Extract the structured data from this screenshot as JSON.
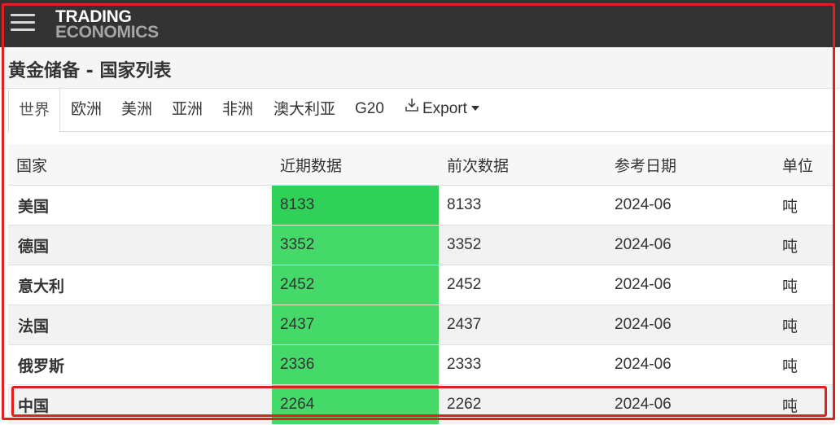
{
  "header": {
    "logo_line1": "TRADING",
    "logo_line2": "ECONOMICS",
    "menu_icon": "hamburger-menu-icon"
  },
  "page_title": "黄金储备 - 国家列表",
  "tabs": [
    {
      "label": "世界",
      "active": true
    },
    {
      "label": "欧洲",
      "active": false
    },
    {
      "label": "美洲",
      "active": false
    },
    {
      "label": "亚洲",
      "active": false
    },
    {
      "label": "非洲",
      "active": false
    },
    {
      "label": "澳大利亚",
      "active": false
    },
    {
      "label": "G20",
      "active": false
    }
  ],
  "export": {
    "label": "Export",
    "icon": "download-icon"
  },
  "table": {
    "headers": [
      "国家",
      "近期数据",
      "前次数据",
      "参考日期",
      "单位"
    ],
    "rows": [
      {
        "country": "美国",
        "latest": "8133",
        "previous": "8133",
        "date": "2024-06",
        "unit": "吨",
        "latest_color": "#2fd158"
      },
      {
        "country": "德国",
        "latest": "3352",
        "previous": "3352",
        "date": "2024-06",
        "unit": "吨",
        "latest_color": "#45d96a"
      },
      {
        "country": "意大利",
        "latest": "2452",
        "previous": "2452",
        "date": "2024-06",
        "unit": "吨",
        "latest_color": "#45d96a"
      },
      {
        "country": "法国",
        "latest": "2437",
        "previous": "2437",
        "date": "2024-06",
        "unit": "吨",
        "latest_color": "#45d96a"
      },
      {
        "country": "俄罗斯",
        "latest": "2336",
        "previous": "2333",
        "date": "2024-06",
        "unit": "吨",
        "latest_color": "#45d96a"
      },
      {
        "country": "中国",
        "latest": "2264",
        "previous": "2262",
        "date": "2024-06",
        "unit": "吨",
        "latest_color": "#45d96a"
      }
    ]
  },
  "colors": {
    "header_bg": "#333333",
    "accent_green": "#45d96a",
    "annotation_red": "#e02020"
  }
}
